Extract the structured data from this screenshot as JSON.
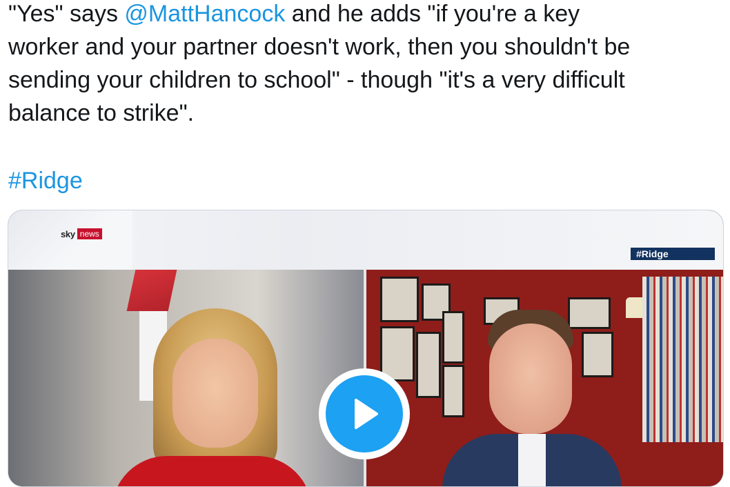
{
  "tweet": {
    "text_before_mention": "\"Yes\" says ",
    "mention": "@MattHancock",
    "text_after_mention": " and he adds \"if you're a key\nworker and your partner doesn't work, then you shouldn't be\nsending your children to school\" - though \"it's a very difficult\nbalance to strike\".",
    "hashtag": "#Ridge"
  },
  "video": {
    "channel_sky": "sky",
    "channel_news": "news",
    "program_hashtag": "#Ridge",
    "play_icon": "play-icon"
  },
  "colors": {
    "link": "#1b95e0",
    "play_button": "#1da1f2",
    "sky_news_red": "#c8102e",
    "hashtag_bug": "#12325f"
  }
}
